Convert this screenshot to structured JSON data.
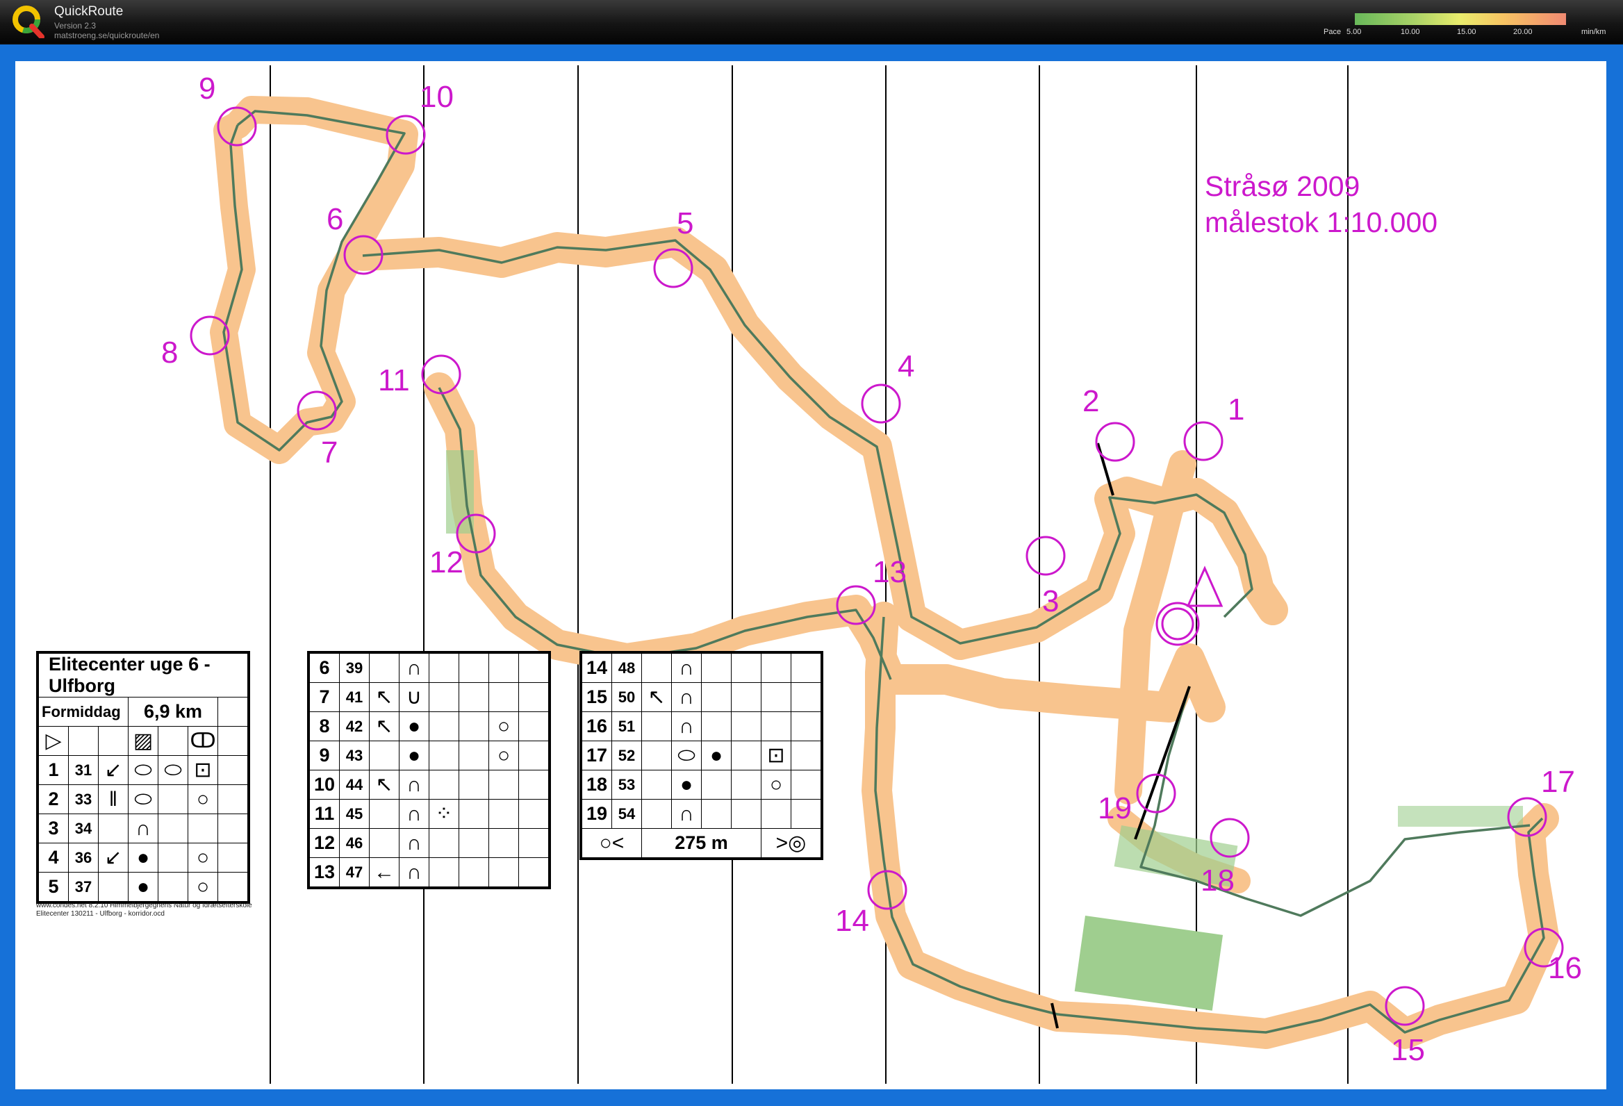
{
  "app": {
    "name": "QuickRoute",
    "version": "Version 2.3",
    "url": "matstroeng.se/quickroute/en"
  },
  "pace": {
    "label": "Pace",
    "ticks": [
      "5.00",
      "10.00",
      "15.00",
      "20.00"
    ],
    "unit": "min/km"
  },
  "map": {
    "title_line1": "Stråsø 2009",
    "title_line2": "målestok 1:10.000",
    "controls": [
      "1",
      "2",
      "3",
      "4",
      "5",
      "6",
      "7",
      "8",
      "9",
      "10",
      "11",
      "12",
      "13",
      "14",
      "15",
      "16",
      "17",
      "18",
      "19"
    ]
  },
  "description": {
    "event": "Elitecenter uge 6 - Ulfborg",
    "class": "Formiddag",
    "length": "6,9 km",
    "rows": [
      {
        "n": "1",
        "code": "31"
      },
      {
        "n": "2",
        "code": "33"
      },
      {
        "n": "3",
        "code": "34"
      },
      {
        "n": "4",
        "code": "36"
      },
      {
        "n": "5",
        "code": "37"
      },
      {
        "n": "6",
        "code": "39"
      },
      {
        "n": "7",
        "code": "41"
      },
      {
        "n": "8",
        "code": "42"
      },
      {
        "n": "9",
        "code": "43"
      },
      {
        "n": "10",
        "code": "44"
      },
      {
        "n": "11",
        "code": "45"
      },
      {
        "n": "12",
        "code": "46"
      },
      {
        "n": "13",
        "code": "47"
      },
      {
        "n": "14",
        "code": "48"
      },
      {
        "n": "15",
        "code": "50"
      },
      {
        "n": "16",
        "code": "51"
      },
      {
        "n": "17",
        "code": "52"
      },
      {
        "n": "18",
        "code": "53"
      },
      {
        "n": "19",
        "code": "54"
      }
    ],
    "finish_distance": "275 m",
    "footer_line1": "www.condes.net 8.2.10 Himmelbjergegnens Natur og Idrætsefterskole",
    "footer_line2": "Elitecenter 130211 - Ulfborg - korridor.ocd"
  },
  "colors": {
    "control": "#cc18cc",
    "frame": "#1671d8",
    "corridor": "#f8c48e",
    "route": "#4f7a5c"
  }
}
